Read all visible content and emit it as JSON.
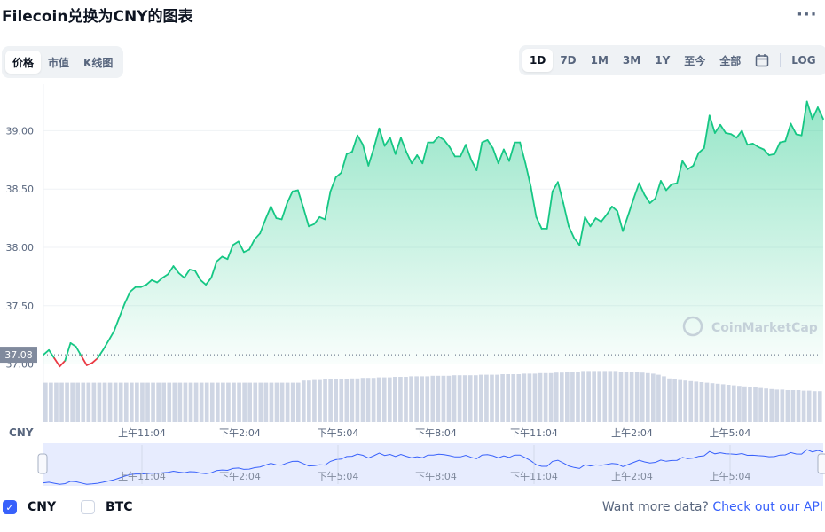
{
  "title": "Filecoin兑换为CNY的图表",
  "menu_icon": "more-dots-icon",
  "metric_tabs": [
    {
      "label": "价格",
      "active": true
    },
    {
      "label": "市值",
      "active": false
    },
    {
      "label": "K线图",
      "active": false
    }
  ],
  "range_tabs": [
    {
      "label": "1D",
      "active": true
    },
    {
      "label": "7D",
      "active": false
    },
    {
      "label": "1M",
      "active": false
    },
    {
      "label": "3M",
      "active": false
    },
    {
      "label": "1Y",
      "active": false
    },
    {
      "label": "至今",
      "active": false
    },
    {
      "label": "全部",
      "active": false
    }
  ],
  "calendar_icon": "calendar-icon",
  "log_label": "LOG",
  "currency_label": "CNY",
  "watermark": "CoinMarketCap",
  "legend": {
    "cny": {
      "label": "CNY",
      "checked": true
    },
    "btc": {
      "label": "BTC",
      "checked": false
    }
  },
  "more_data": {
    "prefix": "Want more data?",
    "link": "Check out our API"
  },
  "colors": {
    "up": "#16c784",
    "down": "#ea3943",
    "navigator": "#3861fb",
    "volume": "#cfd6e4"
  },
  "chart_data": {
    "type": "line",
    "currency": "CNY",
    "open_price": 37.08,
    "open_price_label": "37.08",
    "y_ticks": [
      "37.00",
      "37.50",
      "38.00",
      "38.50",
      "39.00"
    ],
    "ylim": [
      37.0,
      39.2
    ],
    "x_ticks": [
      "上午11:04",
      "下午2:04",
      "下午5:04",
      "下午8:04",
      "下午11:04",
      "上午2:04",
      "上午5:04"
    ],
    "series": [
      {
        "values": [
          37.08,
          37.12,
          37.05,
          36.98,
          37.03,
          37.18,
          37.15,
          37.07,
          36.99,
          37.01,
          37.05,
          37.12,
          37.2,
          37.28,
          37.4,
          37.52,
          37.62,
          37.66,
          37.66,
          37.68,
          37.72,
          37.7,
          37.74,
          37.77,
          37.84,
          37.78,
          37.74,
          37.81,
          37.8,
          37.72,
          37.68,
          37.74,
          37.88,
          37.92,
          37.9,
          38.02,
          38.05,
          37.96,
          37.98,
          38.07,
          38.12,
          38.24,
          38.35,
          38.25,
          38.24,
          38.38,
          38.48,
          38.49,
          38.34,
          38.18,
          38.2,
          38.26,
          38.24,
          38.48,
          38.6,
          38.64,
          38.8,
          38.82,
          38.96,
          38.88,
          38.7,
          38.85,
          39.02,
          38.87,
          38.94,
          38.8,
          38.94,
          38.82,
          38.72,
          38.79,
          38.72,
          38.9,
          38.9,
          38.95,
          38.92,
          38.86,
          38.78,
          38.78,
          38.88,
          38.75,
          38.66,
          38.9,
          38.92,
          38.85,
          38.72,
          38.84,
          38.74,
          38.9,
          38.9,
          38.72,
          38.52,
          38.26,
          38.16,
          38.16,
          38.48,
          38.56,
          38.38,
          38.18,
          38.08,
          38.02,
          38.26,
          38.18,
          38.25,
          38.22,
          38.28,
          38.35,
          38.31,
          38.14,
          38.28,
          38.42,
          38.55,
          38.45,
          38.38,
          38.42,
          38.57,
          38.49,
          38.54,
          38.55,
          38.74,
          38.67,
          38.7,
          38.81,
          38.85,
          39.13,
          38.98,
          39.05,
          38.98,
          38.97,
          38.94,
          39.0,
          38.88,
          38.89,
          38.86,
          38.84,
          38.79,
          38.8,
          38.9,
          38.91,
          39.06,
          38.97,
          38.96,
          39.25,
          39.1,
          39.2,
          39.1
        ]
      }
    ],
    "volume_relative": [
      0.74,
      0.74,
      0.74,
      0.74,
      0.74,
      0.74,
      0.74,
      0.74,
      0.74,
      0.74,
      0.74,
      0.74,
      0.74,
      0.74,
      0.74,
      0.74,
      0.74,
      0.74,
      0.74,
      0.74,
      0.74,
      0.74,
      0.74,
      0.74,
      0.74,
      0.74,
      0.74,
      0.74,
      0.74,
      0.74,
      0.74,
      0.74,
      0.74,
      0.74,
      0.74,
      0.74,
      0.74,
      0.74,
      0.74,
      0.74,
      0.74,
      0.74,
      0.74,
      0.74,
      0.74,
      0.74,
      0.74,
      0.74,
      0.78,
      0.78,
      0.79,
      0.79,
      0.8,
      0.8,
      0.81,
      0.81,
      0.81,
      0.82,
      0.82,
      0.83,
      0.83,
      0.83,
      0.84,
      0.84,
      0.84,
      0.85,
      0.85,
      0.85,
      0.86,
      0.86,
      0.86,
      0.86,
      0.87,
      0.87,
      0.87,
      0.87,
      0.88,
      0.88,
      0.88,
      0.88,
      0.88,
      0.89,
      0.89,
      0.89,
      0.89,
      0.9,
      0.9,
      0.9,
      0.9,
      0.91,
      0.91,
      0.91,
      0.92,
      0.92,
      0.92,
      0.93,
      0.93,
      0.94,
      0.95,
      0.95,
      0.96,
      0.96,
      0.96,
      0.96,
      0.96,
      0.96,
      0.96,
      0.95,
      0.95,
      0.94,
      0.94,
      0.93,
      0.92,
      0.91,
      0.89,
      0.86,
      0.82,
      0.8,
      0.79,
      0.78,
      0.77,
      0.76,
      0.75,
      0.74,
      0.73,
      0.72,
      0.71,
      0.7,
      0.69,
      0.68,
      0.67,
      0.66,
      0.65,
      0.64,
      0.63,
      0.62,
      0.61,
      0.61,
      0.6,
      0.6,
      0.6,
      0.59,
      0.59,
      0.58,
      0.58
    ],
    "grid": true,
    "legend_position": "bottom-left",
    "navigator": true
  }
}
